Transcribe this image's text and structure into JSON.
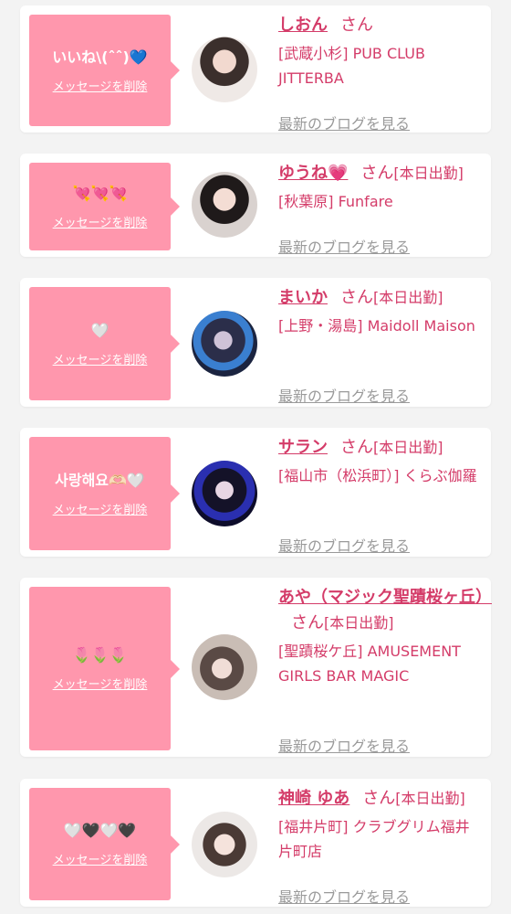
{
  "delete_label": "メッセージを削除",
  "blog_label": "最新のブログを見る",
  "san_label": "さん",
  "status_today": "[本日出勤]",
  "colors": {
    "accent": "#d43c69",
    "bubble": "#ff97ad",
    "muted": "#9a9a9a"
  },
  "cards": [
    {
      "message": "いいね\\(ˆˆ)💙",
      "name": "しおん",
      "status": "",
      "shop": "[武蔵小杉] PUB CLUB JITTERBA"
    },
    {
      "message": "💘💘💘",
      "name": "ゆうね💗",
      "status": "[本日出勤]",
      "shop": "[秋葉原] Funfare"
    },
    {
      "message": "🤍",
      "name": "まいか",
      "status": "[本日出勤]",
      "shop": "[上野・湯島] Maidoll Maison"
    },
    {
      "message": "사랑해요🫶🏻🤍",
      "name": "サラン",
      "status": "[本日出勤]",
      "shop": "[福山市（松浜町）] くらぶ伽羅"
    },
    {
      "message": "🌷🌷🌷",
      "name": "あや（マジック聖蹟桜ヶ丘）",
      "status": "[本日出勤]",
      "shop": "[聖蹟桜ケ丘] AMUSEMENT GIRLS BAR MAGIC"
    },
    {
      "message": "🤍🖤🤍🖤",
      "name": "神崎 ゆあ",
      "status": "[本日出勤]",
      "shop": "[福井片町] クラブグリム福井片町店"
    }
  ]
}
